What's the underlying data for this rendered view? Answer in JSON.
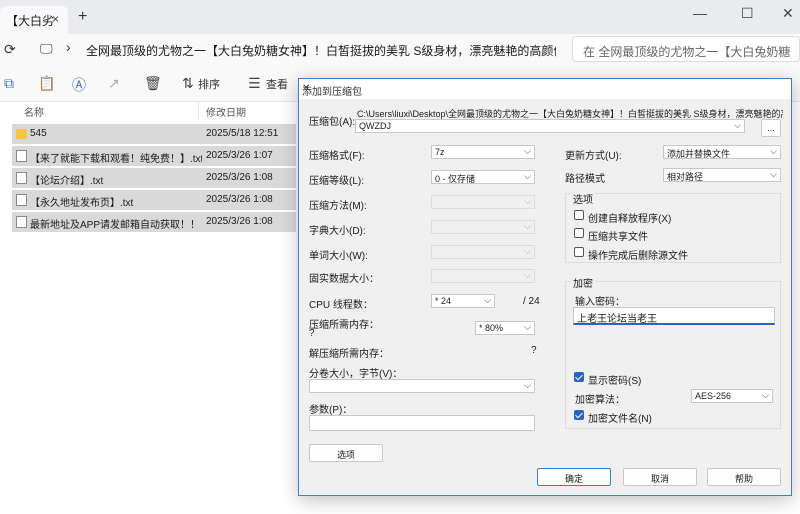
{
  "explorer": {
    "tab_title": "【大白劣",
    "tab_close": "×",
    "new_tab": "+",
    "win_minimize": "—",
    "win_maximize": "☐",
    "win_close": "✕",
    "address_path": "全网最顶级的尤物之一【大白兔奶糖女神】！白皙挺拔的美乳 S级身材，漂亮魅艳的高颜值脸蛋儿，各",
    "search_placeholder": "在 全网最顶级的尤物之一【大白兔奶糖",
    "toolbar": {
      "sort_label": "排序",
      "view_label": "查看"
    },
    "columns": {
      "name": "名称",
      "modified": "修改日期"
    },
    "files": [
      {
        "name": "545",
        "date": "2025/5/18 12:51",
        "type": "folder"
      },
      {
        "name": "【来了就能下载和观看！纯免费！】.txt",
        "date": "2025/3/26 1:07",
        "type": "txt"
      },
      {
        "name": "【论坛介绍】.txt",
        "date": "2025/3/26 1:08",
        "type": "txt"
      },
      {
        "name": "【永久地址发布页】.txt",
        "date": "2025/3/26 1:08",
        "type": "txt"
      },
      {
        "name": "最新地址及APP请发邮箱自动获取！！！...",
        "date": "2025/3/26 1:08",
        "type": "txt"
      }
    ]
  },
  "dialog": {
    "title": "添加到压缩包",
    "close": "✕",
    "archive_label": "压缩包(A):",
    "archive_dir": "C:\\Users\\liuxi\\Desktop\\全网最顶级的尤物之一【大白兔奶糖女神】！白皙挺拔的美乳 S级身材，漂亮魅艳的高颜",
    "archive_name": "QWZDJ",
    "browse_label": "...",
    "left": {
      "format_label": "压缩格式(F):",
      "format_value": "7z",
      "level_label": "压缩等级(L):",
      "level_value": "0 - 仅存储",
      "method_label": "压缩方法(M):",
      "dict_label": "字典大小(D):",
      "word_label": "单词大小(W):",
      "solid_label": "固实数据大小：",
      "cpu_label": "CPU 线程数：",
      "cpu_value": "* 24",
      "cpu_max": "/ 24",
      "mem_comp_label": "压缩所需内存：",
      "mem_comp_q": "?",
      "mem_comp_value": "* 80%",
      "mem_decomp_label": "解压缩所需内存：",
      "mem_decomp_value": "?",
      "split_label": "分卷大小，字节(V)：",
      "params_label": "参数(P)：",
      "options_button": "选项"
    },
    "right": {
      "update_label": "更新方式(U):",
      "update_value": "添加并替换文件",
      "path_label": "路径模式",
      "path_value": "相对路径",
      "options_group": "选项",
      "opt_sfx": "创建自释放程序(X)",
      "opt_shared": "压缩共享文件",
      "opt_delete": "操作完成后删除源文件",
      "encrypt_group": "加密",
      "password_label": "输入密码：",
      "password_value": "上老王论坛当老王",
      "show_password": "显示密码(S)",
      "enc_method_label": "加密算法：",
      "enc_method_value": "AES-256",
      "enc_filenames": "加密文件名(N)"
    },
    "buttons": {
      "ok": "确定",
      "cancel": "取消",
      "help": "帮助"
    }
  }
}
